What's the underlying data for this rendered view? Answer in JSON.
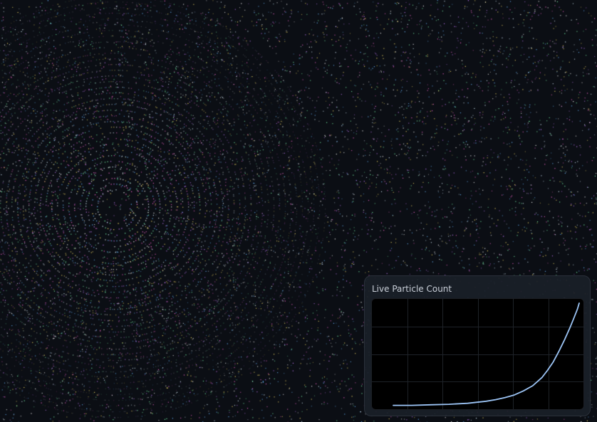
{
  "panel": {
    "title": "Live Particle Count"
  },
  "colors": {
    "background": "#0b0e14",
    "panel": "#1a1f28",
    "plot_background": "#000000",
    "grid": "#1e2228",
    "line": "#9cc4f5",
    "particles": [
      "#ffffff",
      "#d8f0ff",
      "#ff6ad5",
      "#7dffb0",
      "#ffe46a",
      "#6ab8ff",
      "#c77dff"
    ]
  },
  "chart_data": {
    "type": "line",
    "title": "Live Particle Count",
    "xlabel": "",
    "ylabel": "",
    "grid": true,
    "x": [
      0,
      10,
      20,
      30,
      40,
      50,
      55,
      60,
      65,
      70,
      75,
      80,
      83,
      86,
      89,
      92,
      95,
      97,
      99,
      100
    ],
    "y": [
      0.01,
      0.01,
      0.015,
      0.02,
      0.03,
      0.05,
      0.065,
      0.085,
      0.11,
      0.15,
      0.2,
      0.28,
      0.35,
      0.43,
      0.53,
      0.64,
      0.76,
      0.85,
      0.94,
      1.0
    ],
    "xlim": [
      0,
      100
    ],
    "ylim": [
      0,
      1
    ]
  }
}
